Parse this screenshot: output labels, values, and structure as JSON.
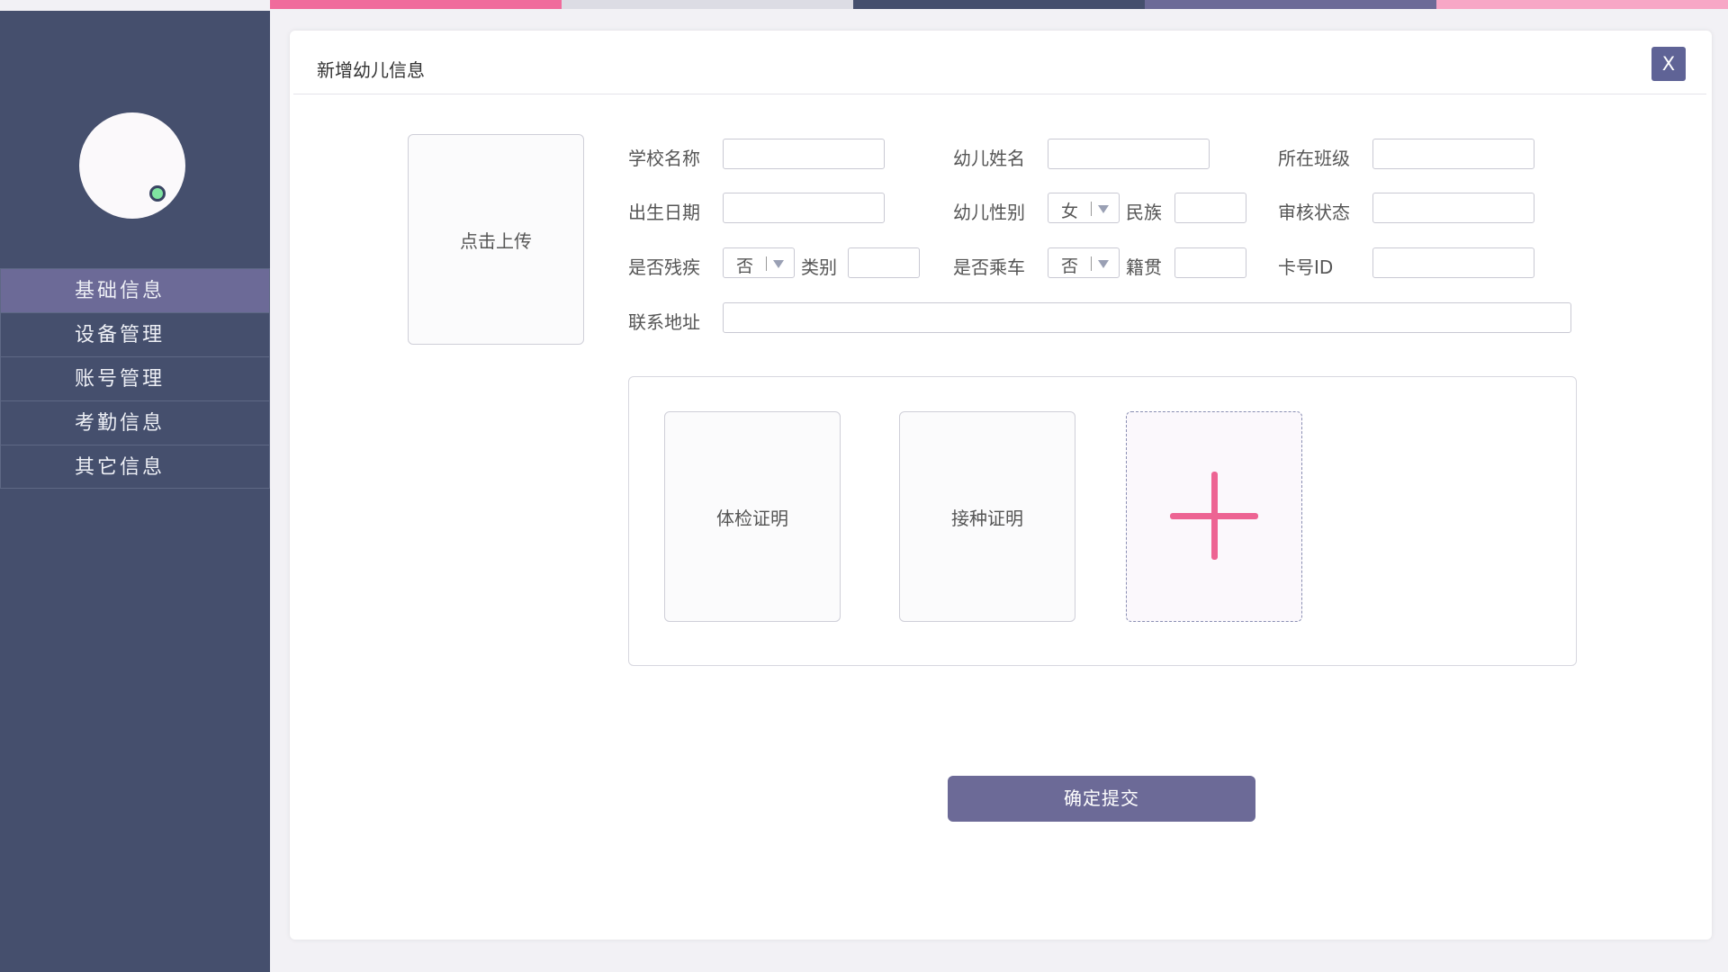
{
  "colors": {
    "sidebar_bg": "#454f6d",
    "accent_purple": "#6c6a97",
    "accent_pink": "#ed6493",
    "status_green": "#7fe3a1",
    "top_strip": [
      "#f06b9c",
      "#dcdce4",
      "#454f6d",
      "#6c6a97",
      "#f7a7c6"
    ]
  },
  "sidebar": {
    "avatar_icon": "avatar",
    "status": "online",
    "items": [
      {
        "label": "基础信息",
        "active": true
      },
      {
        "label": "设备管理",
        "active": false
      },
      {
        "label": "账号管理",
        "active": false
      },
      {
        "label": "考勤信息",
        "active": false
      },
      {
        "label": "其它信息",
        "active": false
      }
    ]
  },
  "dialog": {
    "title": "新增幼儿信息",
    "close_label": "X",
    "photo_upload": "点击上传",
    "fields": {
      "school_name": {
        "label": "学校名称",
        "value": ""
      },
      "child_name": {
        "label": "幼儿姓名",
        "value": ""
      },
      "class": {
        "label": "所在班级",
        "value": ""
      },
      "birth_date": {
        "label": "出生日期",
        "value": ""
      },
      "gender": {
        "label": "幼儿性别",
        "value": "女"
      },
      "ethnicity": {
        "label": "民族",
        "value": ""
      },
      "review_status": {
        "label": "审核状态",
        "value": ""
      },
      "disabled": {
        "label": "是否残疾",
        "value": "否"
      },
      "category": {
        "label": "类别",
        "value": ""
      },
      "bus": {
        "label": "是否乘车",
        "value": "否"
      },
      "native_place": {
        "label": "籍贯",
        "value": ""
      },
      "card_id": {
        "label": "卡号ID",
        "value": ""
      },
      "address": {
        "label": "联系地址",
        "value": ""
      }
    },
    "certificates": [
      {
        "label": "体检证明"
      },
      {
        "label": "接种证明"
      }
    ],
    "add_certificate_icon": "plus-icon",
    "submit_label": "确定提交"
  }
}
